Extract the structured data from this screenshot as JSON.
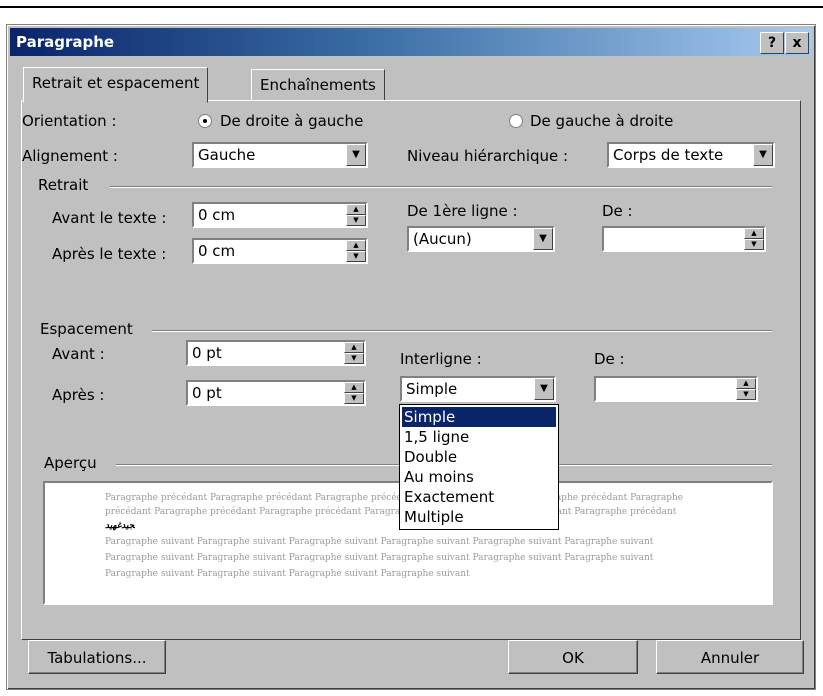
{
  "dialog": {
    "title": "Paragraphe",
    "help_label": "?",
    "close_label": "x"
  },
  "tabs": [
    {
      "label": "Retrait et espacement",
      "active": true
    },
    {
      "label": "Enchaînements",
      "active": false
    }
  ],
  "orientation": {
    "label": "Orientation :",
    "options": [
      {
        "label": "De droite à gauche",
        "selected": true
      },
      {
        "label": "De gauche à droite",
        "selected": false
      }
    ]
  },
  "alignment": {
    "label": "Alignement :",
    "value": "Gauche"
  },
  "outline_level": {
    "label": "Niveau hiérarchique :",
    "value": "Corps de texte"
  },
  "indent": {
    "group_label": "Retrait",
    "before": {
      "label": "Avant le texte :",
      "value": "0 cm"
    },
    "after": {
      "label": "Après le texte :",
      "value": "0 cm"
    },
    "first_line": {
      "label": "De 1ère ligne :",
      "value": "(Aucun)"
    },
    "by": {
      "label": "De :",
      "value": ""
    }
  },
  "spacing": {
    "group_label": "Espacement",
    "before": {
      "label": "Avant :",
      "value": "0 pt"
    },
    "after": {
      "label": "Après :",
      "value": "0 pt"
    },
    "line_spacing": {
      "label": "Interligne :",
      "value": "Simple"
    },
    "by": {
      "label": "De :",
      "value": ""
    },
    "line_spacing_options": [
      "Simple",
      "1,5 ligne",
      "Double",
      "Au moins",
      "Exactement",
      "Multiple"
    ]
  },
  "preview": {
    "group_label": "Aperçu",
    "lines": [
      "Paragraphe précédant Paragraphe précédant Paragraphe précédant Paragraphe précédant Paragraphe précédant Paragraphe",
      "précédant Paragraphe précédant Paragraphe précédant Paragraphe précédant Paragraphe précédant Paragraphe précédant",
      "ﺠﻴﺪﻏﻬﻴﺪ",
      "Paragraphe suivant Paragraphe suivant Paragraphe suivant Paragraphe suivant Paragraphe suivant Paragraphe suivant",
      "Paragraphe suivant Paragraphe suivant Paragraphe suivant Paragraphe suivant Paragraphe suivant Paragraphe suivant",
      "Paragraphe suivant Paragraphe suivant Paragraphe suivant Paragraphe suivant"
    ]
  },
  "buttons": {
    "tabs_label": "Tabulations...",
    "ok_label": "OK",
    "cancel_label": "Annuler"
  }
}
